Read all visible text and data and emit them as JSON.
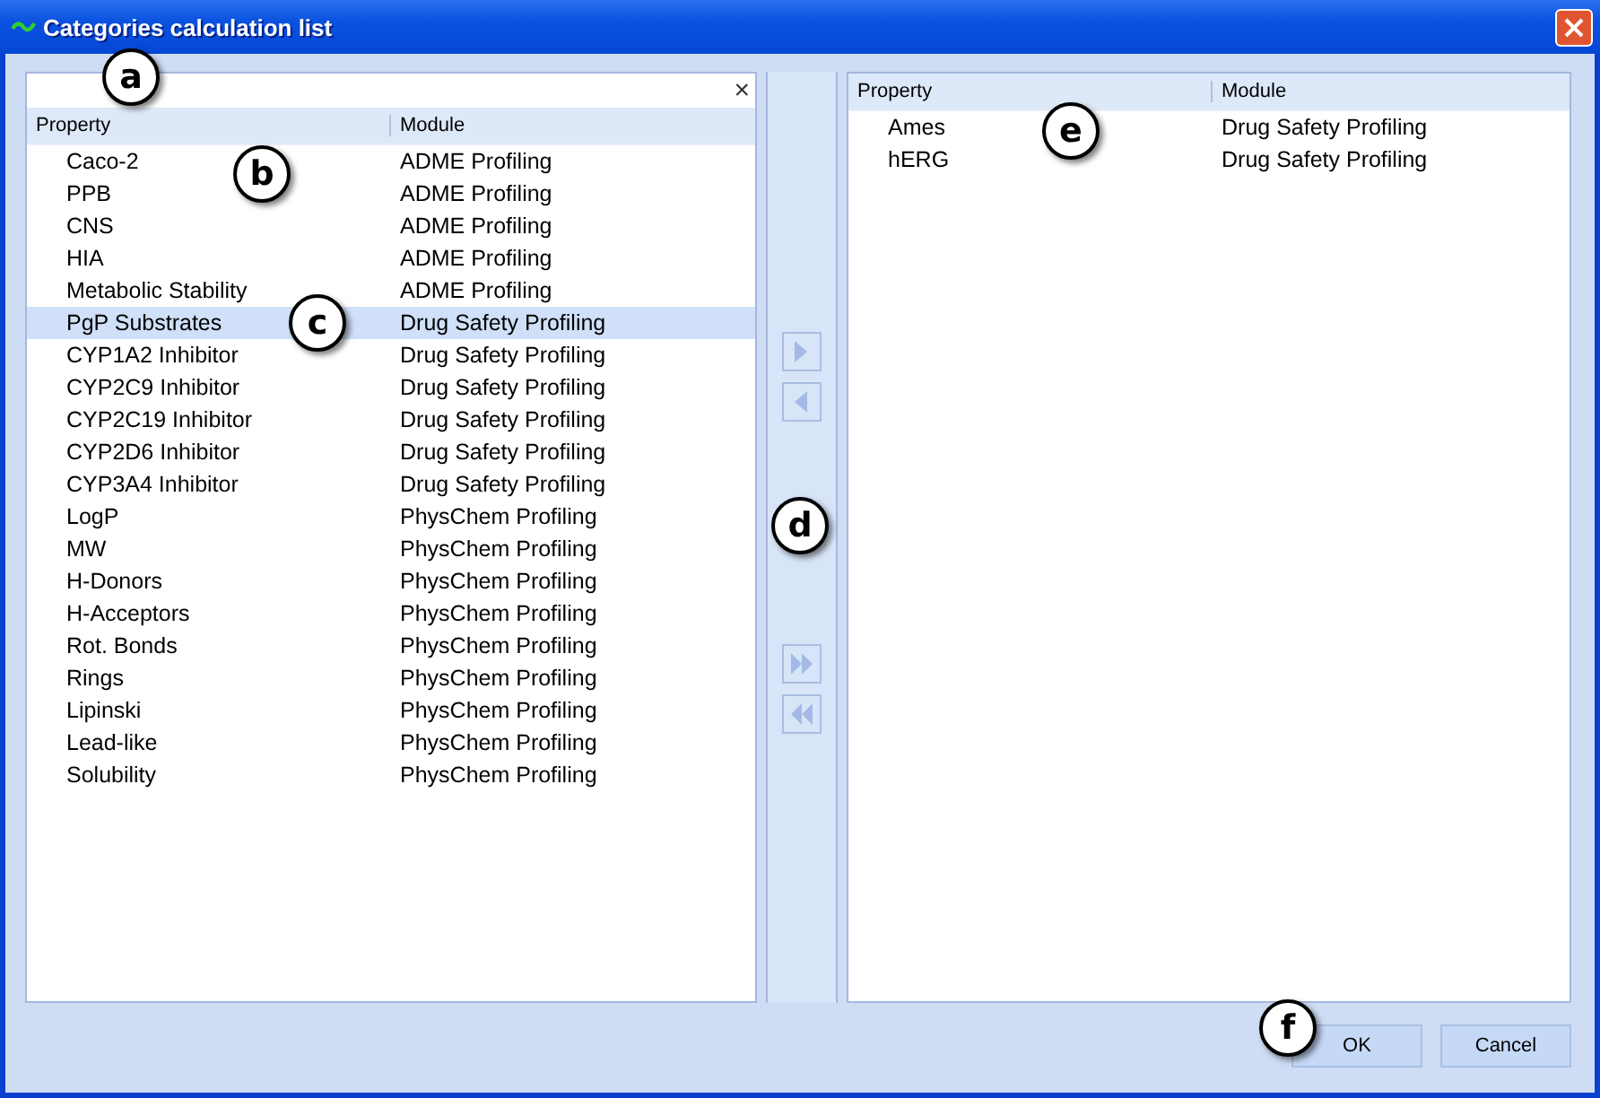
{
  "window": {
    "title": "Categories calculation list"
  },
  "filter": {
    "clear_label": "×"
  },
  "available": {
    "columns": [
      "Property",
      "Module"
    ],
    "rows": [
      {
        "property": "Caco-2",
        "module": "ADME Profiling",
        "selected": false
      },
      {
        "property": "PPB",
        "module": "ADME Profiling",
        "selected": false
      },
      {
        "property": "CNS",
        "module": "ADME Profiling",
        "selected": false
      },
      {
        "property": "HIA",
        "module": "ADME Profiling",
        "selected": false
      },
      {
        "property": "Metabolic Stability",
        "module": "ADME Profiling",
        "selected": false
      },
      {
        "property": "PgP Substrates",
        "module": "Drug Safety Profiling",
        "selected": true
      },
      {
        "property": "CYP1A2 Inhibitor",
        "module": "Drug Safety Profiling",
        "selected": false
      },
      {
        "property": "CYP2C9 Inhibitor",
        "module": "Drug Safety Profiling",
        "selected": false
      },
      {
        "property": "CYP2C19 Inhibitor",
        "module": "Drug Safety Profiling",
        "selected": false
      },
      {
        "property": "CYP2D6 Inhibitor",
        "module": "Drug Safety Profiling",
        "selected": false
      },
      {
        "property": "CYP3A4 Inhibitor",
        "module": "Drug Safety Profiling",
        "selected": false
      },
      {
        "property": "LogP",
        "module": "PhysChem Profiling",
        "selected": false
      },
      {
        "property": "MW",
        "module": "PhysChem Profiling",
        "selected": false
      },
      {
        "property": "H-Donors",
        "module": "PhysChem Profiling",
        "selected": false
      },
      {
        "property": "H-Acceptors",
        "module": "PhysChem Profiling",
        "selected": false
      },
      {
        "property": "Rot. Bonds",
        "module": "PhysChem Profiling",
        "selected": false
      },
      {
        "property": "Rings",
        "module": "PhysChem Profiling",
        "selected": false
      },
      {
        "property": "Lipinski",
        "module": "PhysChem Profiling",
        "selected": false
      },
      {
        "property": "Lead-like",
        "module": "PhysChem Profiling",
        "selected": false
      },
      {
        "property": "Solubility",
        "module": "PhysChem Profiling",
        "selected": false
      }
    ]
  },
  "transfer_buttons": [
    {
      "kind": "add",
      "disabled": true
    },
    {
      "kind": "remove",
      "disabled": true
    },
    {
      "kind": "add-all",
      "disabled": true
    },
    {
      "kind": "remove-all",
      "disabled": true
    }
  ],
  "selected_list": {
    "columns": [
      "Property",
      "Module"
    ],
    "rows": [
      {
        "property": "Ames",
        "module": "Drug Safety Profiling",
        "selected": false
      },
      {
        "property": "hERG",
        "module": "Drug Safety Profiling",
        "selected": false
      }
    ]
  },
  "buttons": [
    "OK",
    "Cancel"
  ],
  "callouts": [
    {
      "label": "a"
    },
    {
      "label": "b"
    },
    {
      "label": "c"
    },
    {
      "label": "d"
    },
    {
      "label": "e"
    },
    {
      "label": "f"
    }
  ]
}
